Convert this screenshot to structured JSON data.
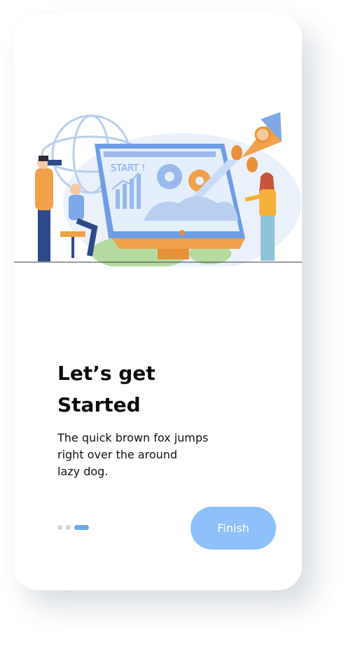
{
  "onboarding": {
    "title": "Let’s get\nStarted",
    "description": "The quick brown fox jumps\nright over the around\nlazy dog.",
    "illustration_text": "START !",
    "finish_label": "Finish",
    "page_indicator": {
      "total": 3,
      "active_index": 2
    }
  },
  "colors": {
    "accent": "#8ec0fb",
    "dot_active": "#6aa8f2",
    "dot_inactive": "#d6d6d6",
    "illustration_orange": "#f0a14a",
    "illustration_blue": "#7fa8e8"
  }
}
